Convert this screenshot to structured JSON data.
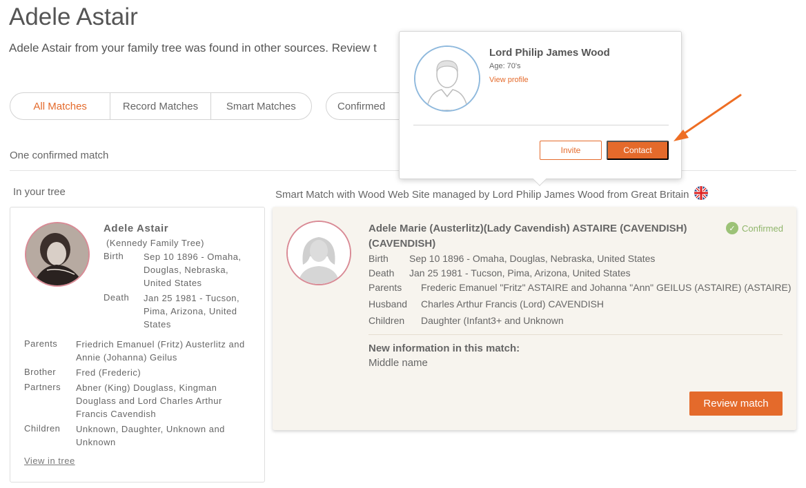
{
  "page": {
    "title": "Adele Astair",
    "subtitle": "Adele Astair from your family tree was found in other sources. Review t"
  },
  "filters": {
    "tabs": [
      {
        "label": "All Matches",
        "active": true
      },
      {
        "label": "Record Matches",
        "active": false
      },
      {
        "label": "Smart Matches",
        "active": false
      }
    ],
    "confirmed_label": "Confirmed"
  },
  "summary": {
    "confirmed_count_text": "One confirmed match"
  },
  "columns": {
    "left_title": "In your tree",
    "right_title": "Smart Match with Wood Web Site managed by Lord Philip James Wood from Great Britain",
    "right_flag_icon": "uk-flag-icon"
  },
  "tree_person": {
    "name": "Adele Astair",
    "tree": "(Kennedy Family Tree)",
    "birth_label": "Birth",
    "birth_lines": [
      "Sep 10 1896 - Omaha,",
      "Douglas, Nebraska,",
      "United States"
    ],
    "death_label": "Death",
    "death_lines": [
      "Jan 25 1981 - Tucson,",
      "Pima, Arizona, United",
      "States"
    ],
    "parents_label": "Parents",
    "parents_lines": [
      "Friedrich Emanuel (Fritz) Austerlitz and",
      "Annie (Johanna) Geilus"
    ],
    "brother_label": "Brother",
    "brother_value": "Fred (Frederic)",
    "partners_label": "Partners",
    "partners_lines": [
      "Abner (King) Douglass, Kingman",
      "Douglass and Lord Charles Arthur",
      "Francis Cavendish"
    ],
    "children_label": "Children",
    "children_lines": [
      "Unknown, Daughter, Unknown and",
      "Unknown"
    ],
    "view_link": "View in tree"
  },
  "match_person": {
    "name_line1": "Adele Marie (Austerlitz)(Lady Cavendish) ASTAIRE (CAVENDISH)",
    "name_line2": "(CAVENDISH)",
    "status": "Confirmed",
    "status_color": "#8fb56a",
    "birth_label": "Birth",
    "birth_value": "Sep 10 1896 - Omaha, Douglas, Nebraska, United States",
    "death_label": "Death",
    "death_value": "Jan 25 1981 - Tucson, Pima, Arizona, United States",
    "parents_label": "Parents",
    "parents_value": "Frederic Emanuel \"Fritz\" ASTAIRE and Johanna \"Ann\" GEILUS (ASTAIRE) (ASTAIRE)",
    "husband_label": "Husband",
    "husband_value": "Charles Arthur Francis (Lord) CAVENDISH",
    "children_label": "Children",
    "children_value": "Daughter (Infant3+ and Unknown",
    "new_info_title": "New information in this match:",
    "new_info_value": "Middle name",
    "review_button": "Review match"
  },
  "popup": {
    "name": "Lord Philip James Wood",
    "age": "Age: 70's",
    "view_profile": "View profile",
    "invite_button": "Invite",
    "contact_button": "Contact"
  },
  "colors": {
    "accent": "#e46a2b",
    "card_bg": "#f7f4ee",
    "avatar_border": "#d98a95",
    "popup_avatar_border": "#8fb9dd"
  }
}
